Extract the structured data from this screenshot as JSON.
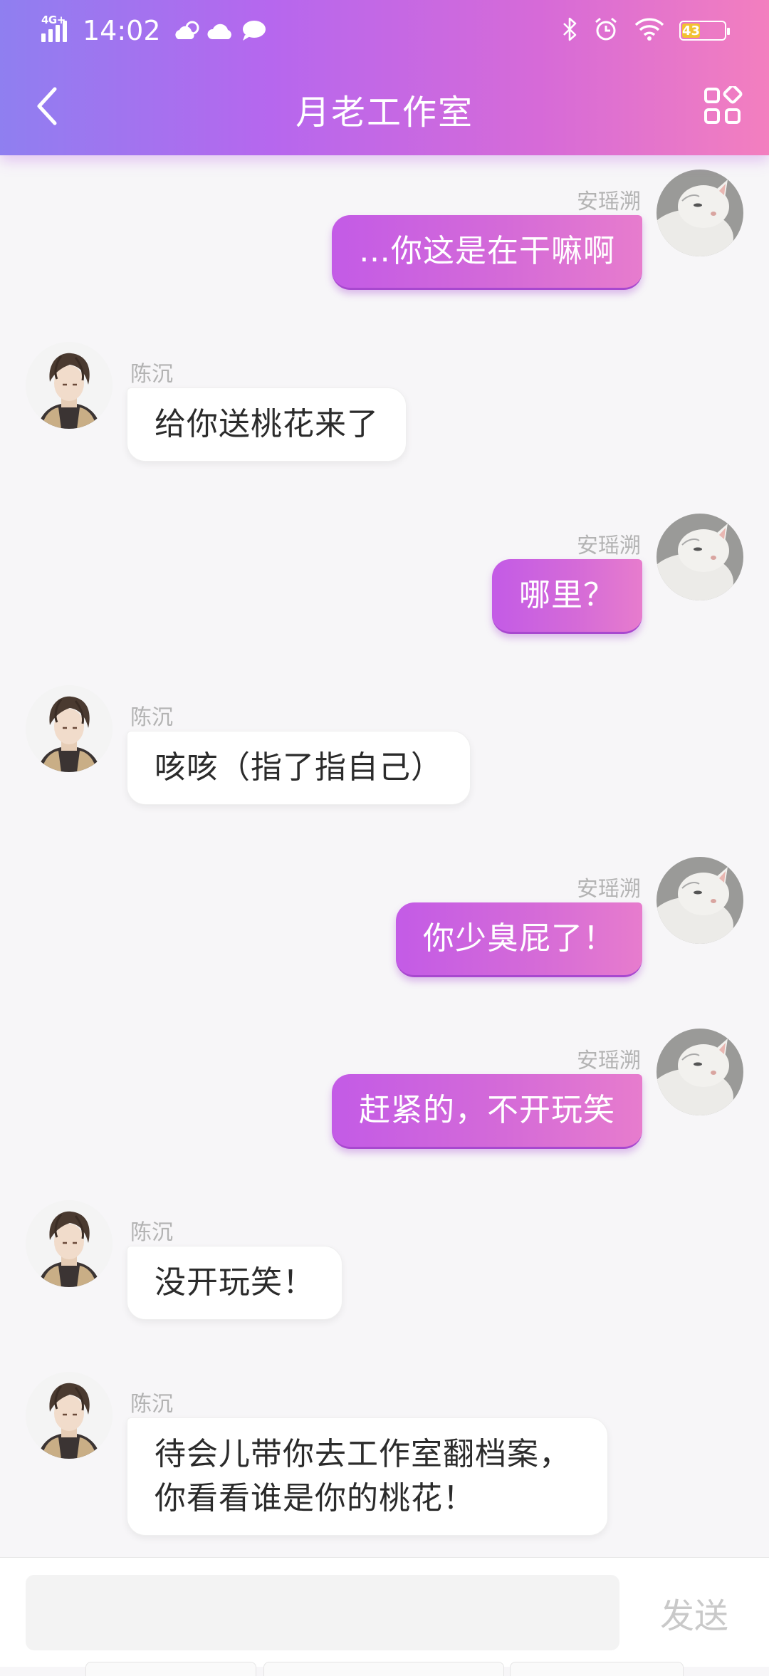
{
  "status_bar": {
    "network": "4G+",
    "time": "14:02",
    "battery": "43"
  },
  "header": {
    "title": "月老工作室"
  },
  "messages": [
    {
      "side": "right",
      "sender": "安瑶溯",
      "text": "…你这是在干嘛啊"
    },
    {
      "side": "left",
      "sender": "陈沉",
      "text": "给你送桃花来了"
    },
    {
      "side": "right",
      "sender": "安瑶溯",
      "text": "哪里？"
    },
    {
      "side": "left",
      "sender": "陈沉",
      "text": "咳咳（指了指自己）"
    },
    {
      "side": "right",
      "sender": "安瑶溯",
      "text": "你少臭屁了！"
    },
    {
      "side": "right",
      "sender": "安瑶溯",
      "text": "赶紧的，不开玩笑"
    },
    {
      "side": "left",
      "sender": "陈沉",
      "text": "没开玩笑！"
    },
    {
      "side": "left",
      "sender": "陈沉",
      "text": "待会儿带你去工作室翻档案，你看看谁是你的桃花！"
    }
  ],
  "input": {
    "value": "",
    "placeholder": "",
    "send_label": "发送"
  },
  "colors": {
    "header_gradient_start": "#8f7ff0",
    "header_gradient_end": "#f37fbf",
    "user_bubble": "#d46ad8",
    "other_bubble": "#ffffff",
    "battery_fill": "#f2c230"
  },
  "icons": {
    "back": "chevron-left-icon",
    "apps": "grid-apps-icon",
    "bluetooth": "bluetooth-icon",
    "alarm": "alarm-icon",
    "wifi": "wifi-icon"
  }
}
